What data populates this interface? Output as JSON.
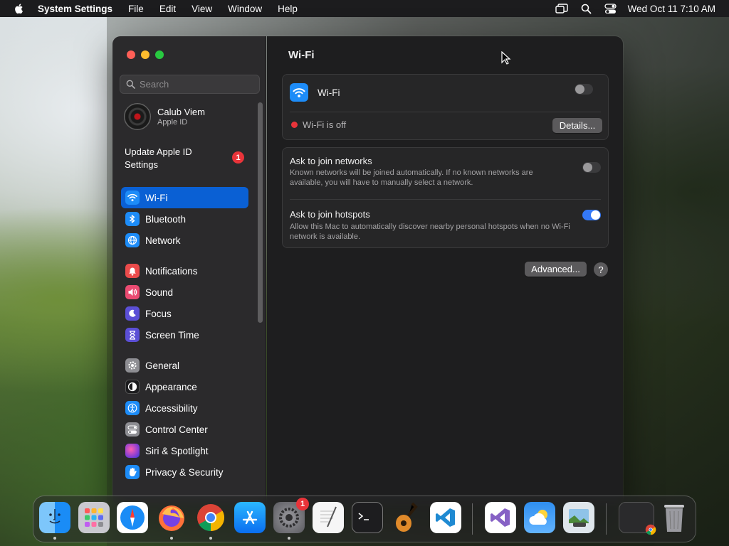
{
  "menubar": {
    "app_name": "System Settings",
    "items": [
      "File",
      "Edit",
      "View",
      "Window",
      "Help"
    ],
    "clock": "Wed Oct 11  7:10 AM"
  },
  "sidebar": {
    "search_placeholder": "Search",
    "account": {
      "name": "Calub Viem",
      "subtitle": "Apple ID"
    },
    "update": {
      "line1": "Update Apple ID",
      "line2": "Settings",
      "badge": "1"
    },
    "groups": [
      [
        {
          "label": "Wi-Fi",
          "icon": "wifi-icon",
          "color": "#1d8cf8",
          "active": true
        },
        {
          "label": "Bluetooth",
          "icon": "bluetooth-icon",
          "color": "#1d8cf8"
        },
        {
          "label": "Network",
          "icon": "globe-icon",
          "color": "#1d8cf8"
        }
      ],
      [
        {
          "label": "Notifications",
          "icon": "bell-icon",
          "color": "#eb4b4b"
        },
        {
          "label": "Sound",
          "icon": "speaker-icon",
          "color": "#eb4b72"
        },
        {
          "label": "Focus",
          "icon": "moon-icon",
          "color": "#5b4fd6"
        },
        {
          "label": "Screen Time",
          "icon": "hourglass-icon",
          "color": "#5b4fd6"
        }
      ],
      [
        {
          "label": "General",
          "icon": "gear-icon",
          "color": "#8e8e93"
        },
        {
          "label": "Appearance",
          "icon": "appearance-icon",
          "color": "#1c1c1e"
        },
        {
          "label": "Accessibility",
          "icon": "accessibility-icon",
          "color": "#1d8cf8"
        },
        {
          "label": "Control Center",
          "icon": "control-center-icon",
          "color": "#8e8e93"
        },
        {
          "label": "Siri & Spotlight",
          "icon": "siri-icon",
          "color": "#8a3fd1"
        },
        {
          "label": "Privacy & Security",
          "icon": "hand-icon",
          "color": "#1d8cf8"
        }
      ]
    ]
  },
  "content": {
    "title": "Wi-Fi",
    "wifi_label": "Wi-Fi",
    "wifi_enabled": false,
    "status_text": "Wi-Fi is off",
    "status_color": "#e9343a",
    "details_button": "Details...",
    "ask_networks_title": "Ask to join networks",
    "ask_networks_desc": "Known networks will be joined automatically. If no known networks are available, you will have to manually select a network.",
    "ask_networks_enabled": false,
    "ask_hotspots_title": "Ask to join hotspots",
    "ask_hotspots_desc": "Allow this Mac to automatically discover nearby personal hotspots when no Wi-Fi network is available.",
    "ask_hotspots_enabled": true,
    "advanced_button": "Advanced...",
    "help_button": "?"
  },
  "dock": {
    "apps": [
      {
        "name": "Finder",
        "icon": "finder-icon",
        "running": true
      },
      {
        "name": "Launchpad",
        "icon": "launchpad-icon",
        "running": false
      },
      {
        "name": "Safari",
        "icon": "safari-icon",
        "running": false
      },
      {
        "name": "Firefox",
        "icon": "firefox-icon",
        "running": true
      },
      {
        "name": "Chrome",
        "icon": "chrome-icon",
        "running": true
      },
      {
        "name": "App Store",
        "icon": "app-store-icon",
        "running": false
      },
      {
        "name": "System Settings",
        "icon": "system-settings-icon",
        "running": true,
        "badge": "1"
      },
      {
        "name": "TextEdit",
        "icon": "textedit-icon",
        "running": false
      },
      {
        "name": "Terminal",
        "icon": "terminal-icon",
        "running": false
      },
      {
        "name": "GarageBand",
        "icon": "garageband-icon",
        "running": false
      },
      {
        "name": "Visual Studio Code",
        "icon": "vscode-icon",
        "running": false
      },
      {
        "name": "Visual Studio",
        "icon": "visual-studio-icon",
        "running": false
      },
      {
        "name": "Weather",
        "icon": "weather-icon",
        "running": false
      },
      {
        "name": "Preview",
        "icon": "preview-icon",
        "running": false
      },
      {
        "name": "Recent Chrome Window",
        "icon": "chrome-window-icon",
        "running": false
      },
      {
        "name": "Trash",
        "icon": "trash-icon",
        "running": false
      }
    ]
  }
}
